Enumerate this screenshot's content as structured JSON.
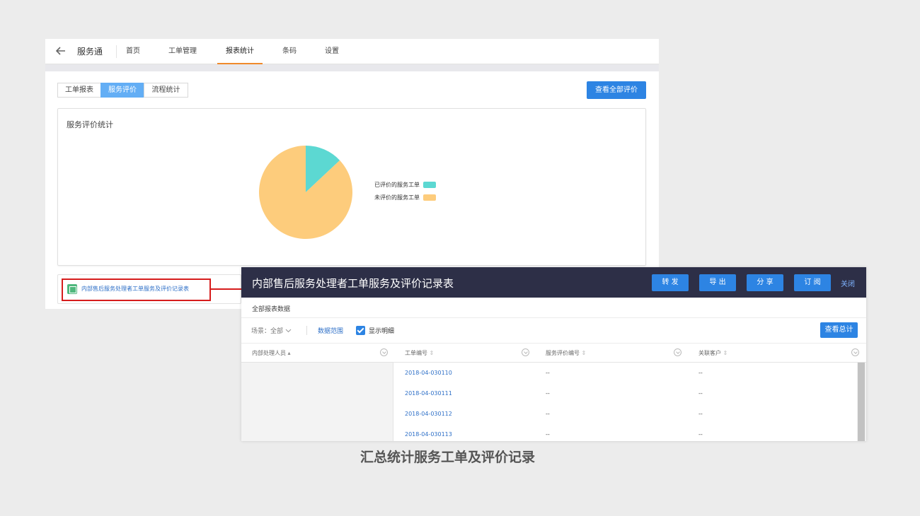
{
  "app": {
    "title": "服务通",
    "nav": [
      "首页",
      "工单管理",
      "报表统计",
      "条码",
      "设置"
    ],
    "active_nav": "报表统计"
  },
  "segments": [
    "工单报表",
    "服务评价",
    "流程统计"
  ],
  "active_segment": "服务评价",
  "view_all_button": "查看全部评价",
  "card": {
    "title": "服务评价统计"
  },
  "chart_data": {
    "type": "pie",
    "title": "服务评价统计",
    "legend_position": "right",
    "slices": [
      {
        "label": "已评价的服务工单",
        "value": 13,
        "color": "#5cd8d2"
      },
      {
        "label": "未评价的服务工单",
        "value": 87,
        "color": "#fdcc7c"
      }
    ]
  },
  "report_link": "内部售后服务处理者工单服务及评价记录表",
  "report": {
    "title": "内部售后服务处理者工单服务及评价记录表",
    "buttons": [
      "转 发",
      "导 出",
      "分 享",
      "订 阅"
    ],
    "close": "关闭",
    "subtitle": "全部报表数据",
    "scene_label": "场景：全部",
    "range_label": "数据范围",
    "show_detail_label": "显示明细",
    "summary_button": "查看总计",
    "columns": [
      "内部处理人员",
      "工单编号",
      "服务评价编号",
      "关联客户"
    ],
    "rows": [
      {
        "ticket": "2018-04-030110",
        "review": "--",
        "customer": "--"
      },
      {
        "ticket": "2018-04-030111",
        "review": "--",
        "customer": "--"
      },
      {
        "ticket": "2018-04-030112",
        "review": "--",
        "customer": "--"
      },
      {
        "ticket": "2018-04-030113",
        "review": "--",
        "customer": "--"
      }
    ]
  },
  "caption": "汇总统计服务工单及评价记录"
}
